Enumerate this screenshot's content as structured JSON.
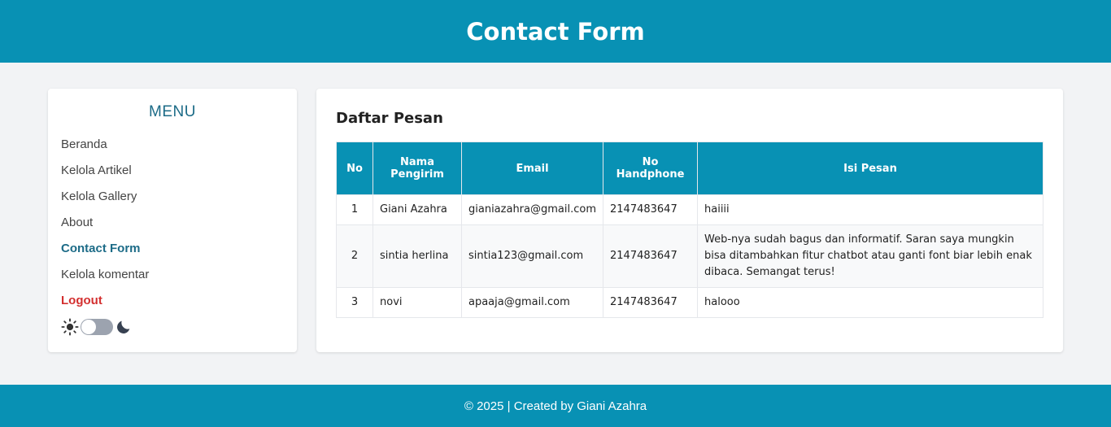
{
  "header": {
    "title": "Contact Form"
  },
  "sidebar": {
    "title": "MENU",
    "items": [
      {
        "label": "Beranda"
      },
      {
        "label": "Kelola Artikel"
      },
      {
        "label": "Kelola Gallery"
      },
      {
        "label": "About"
      },
      {
        "label": "Contact Form"
      },
      {
        "label": "Kelola komentar"
      },
      {
        "label": "Logout"
      }
    ],
    "theme_toggle": {
      "state": "light",
      "icons": [
        "sun-icon",
        "moon-icon"
      ]
    }
  },
  "main": {
    "heading": "Daftar Pesan",
    "table": {
      "columns": [
        "No",
        "Nama Pengirim",
        "Email",
        "No Handphone",
        "Isi Pesan"
      ],
      "rows": [
        {
          "no": "1",
          "name": "Giani Azahra",
          "email": "gianiazahra@gmail.com",
          "phone": "2147483647",
          "message": "haiiii"
        },
        {
          "no": "2",
          "name": "sintia herlina",
          "email": "sintia123@gmail.com",
          "phone": "2147483647",
          "message": "Web-nya sudah bagus dan informatif. Saran saya mungkin bisa ditambahkan fitur chatbot atau ganti font biar lebih enak dibaca. Semangat terus!"
        },
        {
          "no": "3",
          "name": "novi",
          "email": "apaaja@gmail.com",
          "phone": "2147483647",
          "message": "halooo"
        }
      ]
    }
  },
  "footer": {
    "text": "© 2025 | Created by Giani Azahra"
  },
  "colors": {
    "primary": "#0891b4",
    "menu_accent": "#1c6b87",
    "logout": "#d32f2f",
    "background": "#f2f3f5"
  }
}
